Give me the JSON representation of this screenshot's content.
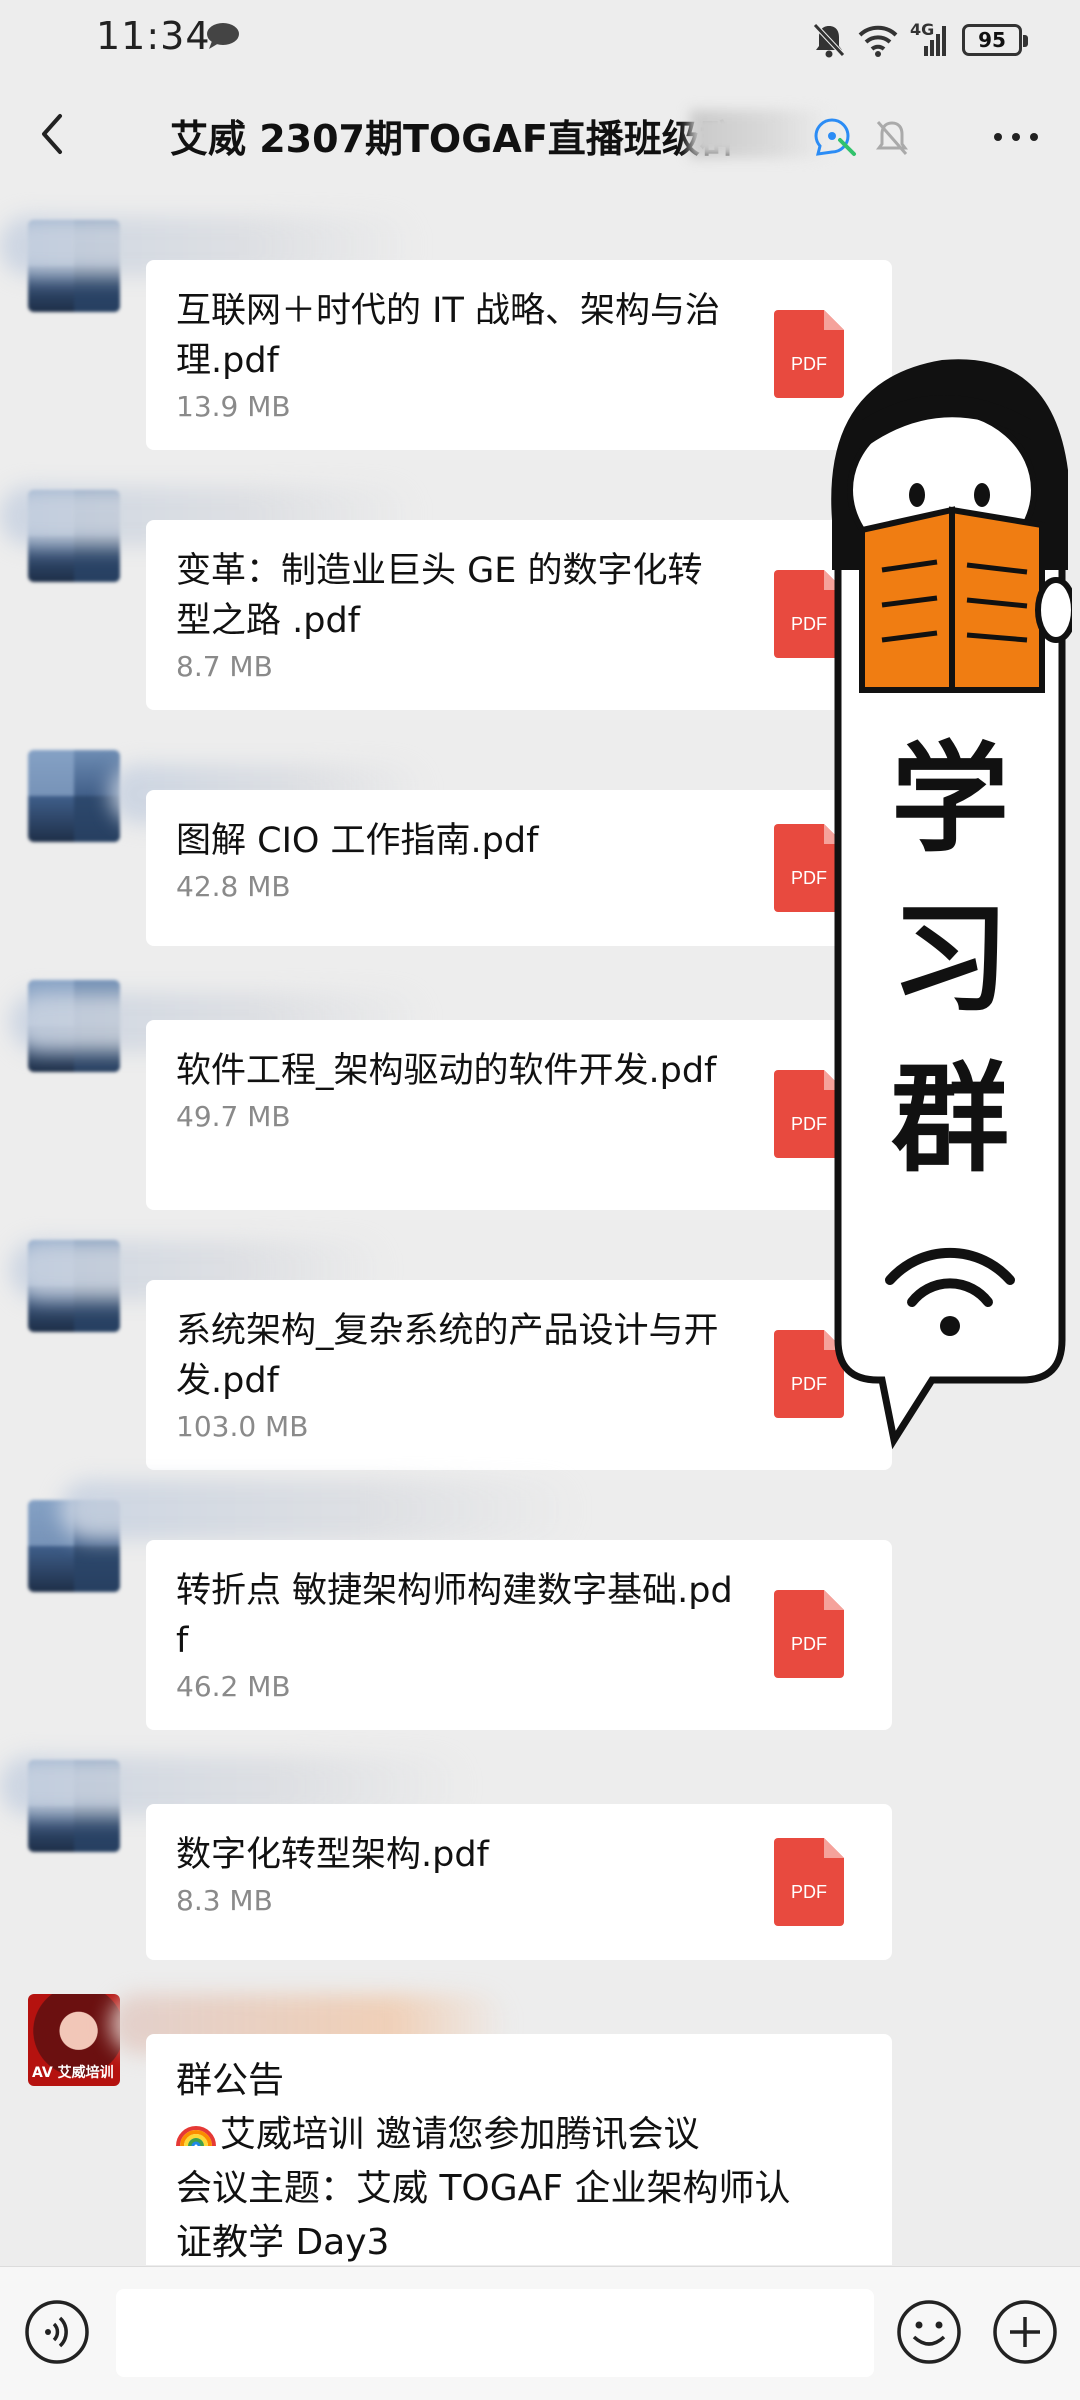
{
  "status_bar": {
    "time": "11:34",
    "network": "4G",
    "battery": "95",
    "icons": [
      "chat-bubble-icon",
      "bell-muted-icon",
      "wifi-icon",
      "signal-icon",
      "battery-icon"
    ]
  },
  "header": {
    "title": "艾威 2307期TOGAF直播班级群",
    "icons": [
      "back-arrow-icon",
      "voice-room-icon",
      "mute-bell-icon",
      "more-dots-icon"
    ]
  },
  "files": [
    {
      "name": "互联网＋时代的 IT 战略、架构与治理.pdf",
      "size": "13.9 MB",
      "type": "PDF"
    },
    {
      "name": "变革：制造业巨头 GE 的数字化转型之路 .pdf",
      "size": "8.7 MB",
      "type": "PDF"
    },
    {
      "name": "图解 CIO 工作指南.pdf",
      "size": "42.8 MB",
      "type": "PDF"
    },
    {
      "name": "软件工程_架构驱动的软件开发.pdf",
      "size": "49.7 MB",
      "type": "PDF"
    },
    {
      "name": "系统架构_复杂系统的产品设计与开发.pdf",
      "size": "103.0 MB",
      "type": "PDF"
    },
    {
      "name": "转折点 敏捷架构师构建数字基础.pdf",
      "size": "46.2 MB",
      "type": "PDF"
    },
    {
      "name": "数字化转型架构.pdf",
      "size": "8.3 MB",
      "type": "PDF"
    }
  ],
  "notice": {
    "title": "群公告",
    "line1": "艾威培训 邀请您参加腾讯会议",
    "line2": "会议主题：艾威 TOGAF 企业架构师认",
    "line3": "证教学 Day3",
    "avatar_tag": "AV 艾威培训"
  },
  "sticker": {
    "chars": [
      "学",
      "习",
      "群"
    ],
    "icon": "wifi-icon",
    "colors": {
      "book": "#f07d12",
      "outline": "#111111"
    }
  },
  "input_bar": {
    "placeholder": "",
    "icons": [
      "voice-input-icon",
      "emoji-icon",
      "plus-icon"
    ]
  },
  "colors": {
    "background": "#ededed",
    "pdf_red": "#e84a3f",
    "bubble": "#ffffff"
  }
}
